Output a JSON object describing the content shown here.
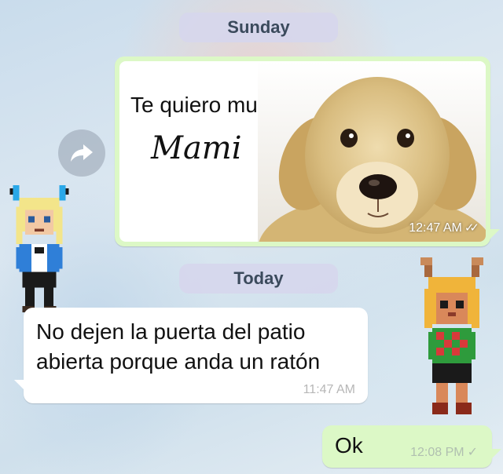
{
  "date_separators": {
    "first": "Sunday",
    "second": "Today"
  },
  "messages": {
    "image_card": {
      "caption": "Te quiero mucho",
      "script_text": "Mami",
      "time": "12:47 AM",
      "status_icon": "double-check-icon"
    },
    "incoming": {
      "text": "No dejen la puerta del patio abierta porque anda un ratón",
      "time": "11:47 AM"
    },
    "outgoing_reply": {
      "text": "Ok",
      "time": "12:08 PM",
      "status_icon": "single-check-icon"
    }
  },
  "actions": {
    "forward_icon": "forward-arrow-icon"
  },
  "colors": {
    "outgoing_bubble": "#dcf8c6",
    "incoming_bubble": "#ffffff",
    "date_pill": "#d6d6ec"
  }
}
